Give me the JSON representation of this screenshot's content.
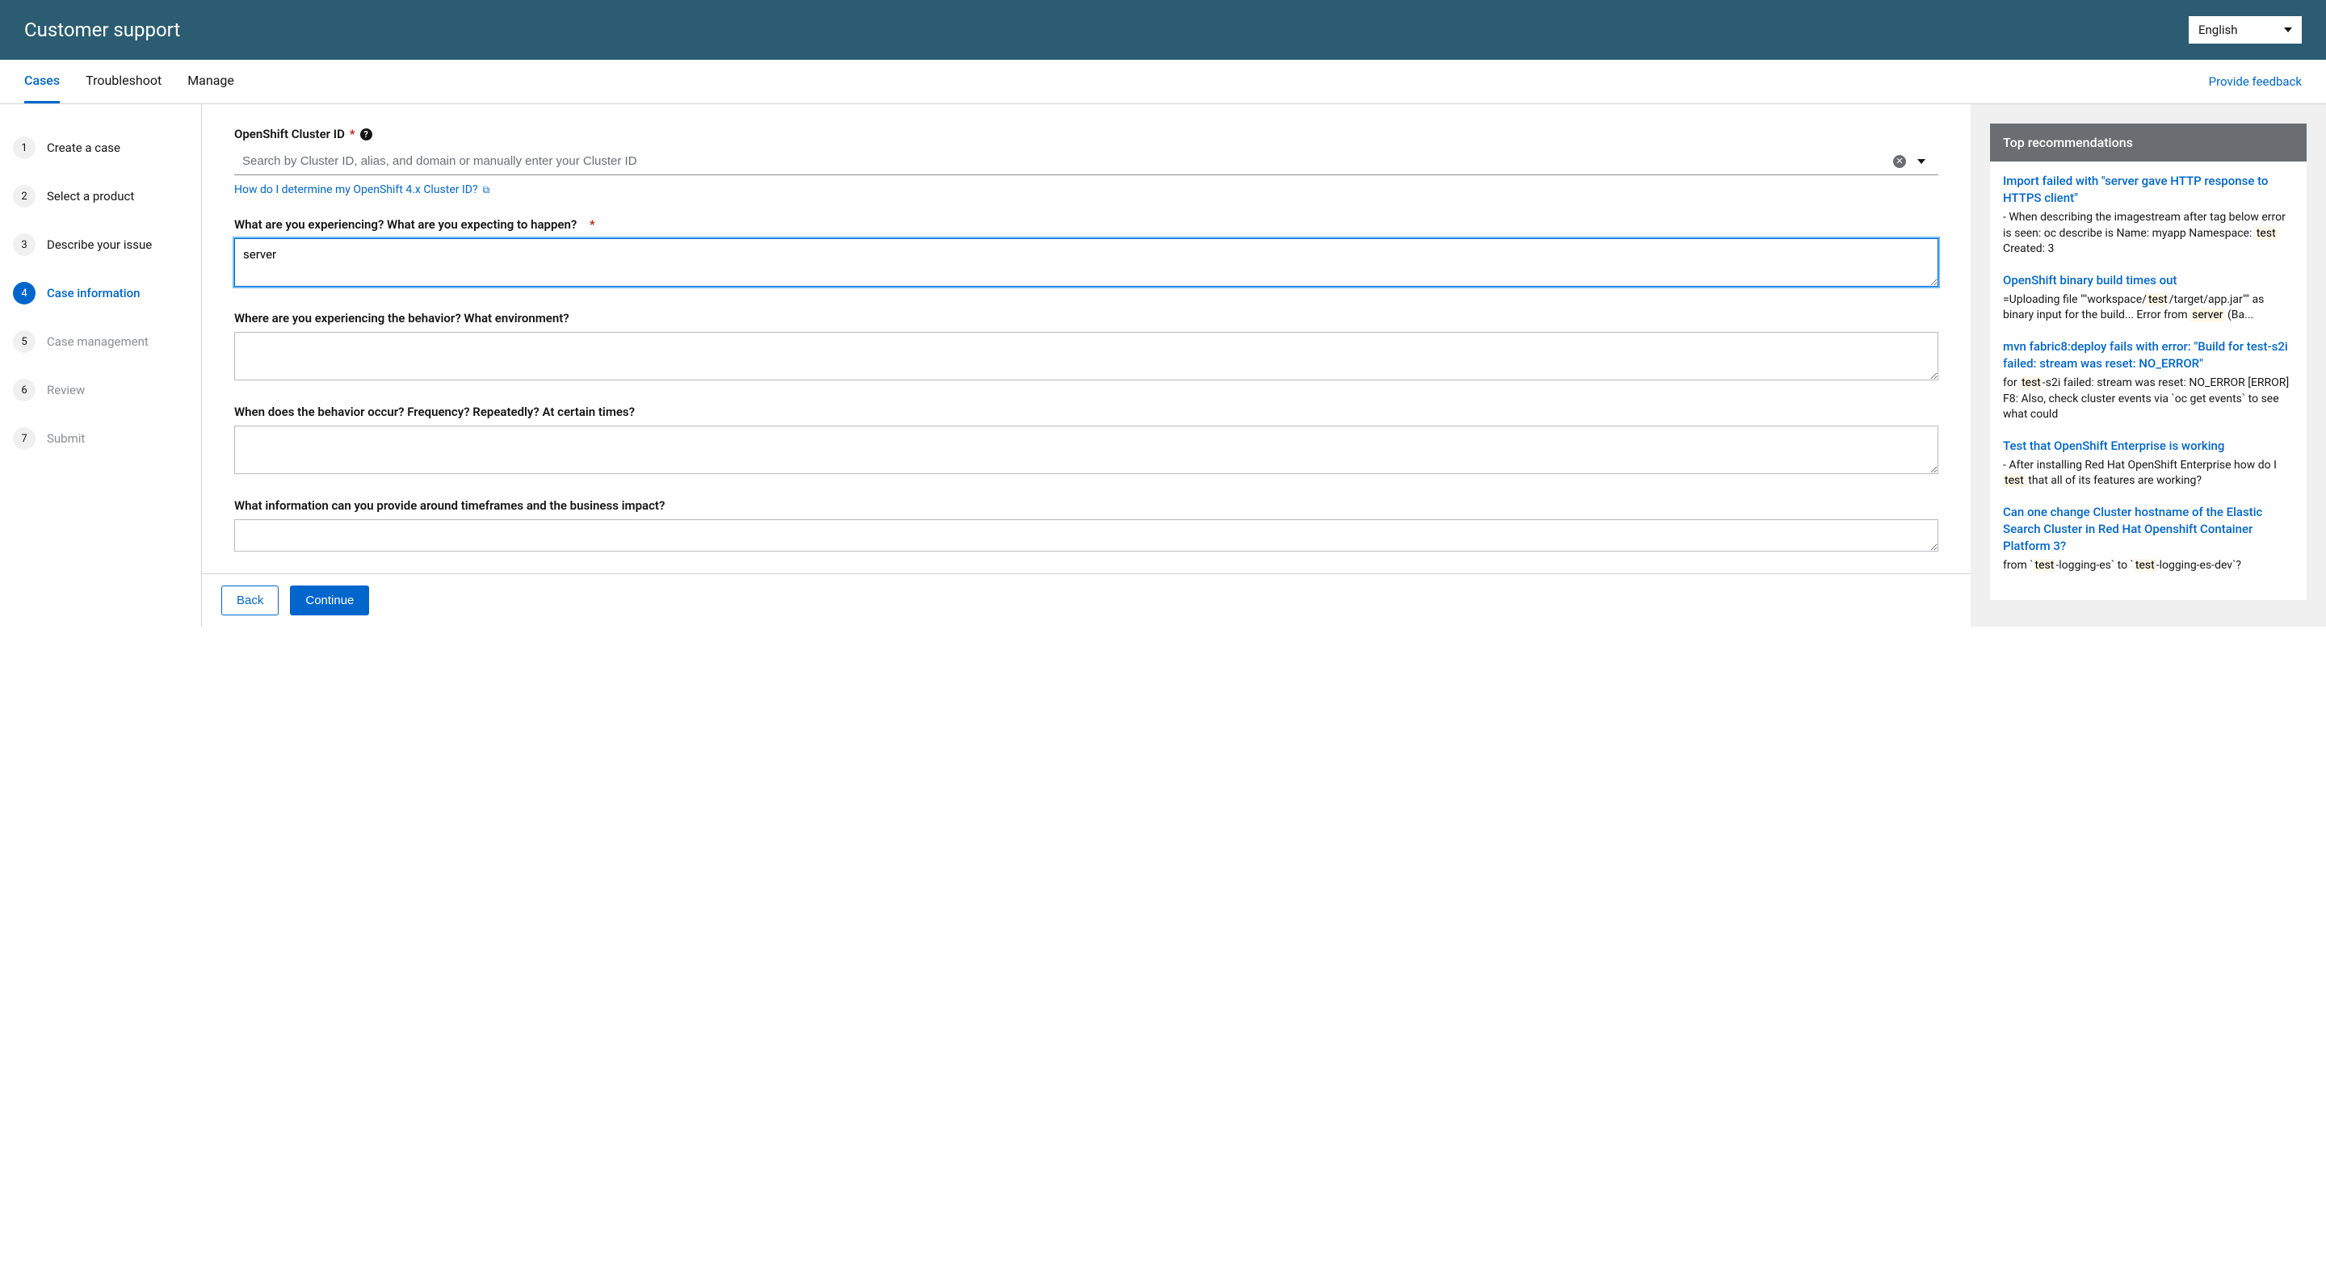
{
  "header": {
    "title": "Customer support",
    "language": "English"
  },
  "tabs": {
    "items": [
      {
        "label": "Cases",
        "active": true
      },
      {
        "label": "Troubleshoot",
        "active": false
      },
      {
        "label": "Manage",
        "active": false
      }
    ],
    "feedback": "Provide feedback"
  },
  "steps": [
    {
      "num": "1",
      "label": "Create a case",
      "state": "done"
    },
    {
      "num": "2",
      "label": "Select a product",
      "state": "done"
    },
    {
      "num": "3",
      "label": "Describe your issue",
      "state": "done"
    },
    {
      "num": "4",
      "label": "Case information",
      "state": "active"
    },
    {
      "num": "5",
      "label": "Case management",
      "state": "disabled"
    },
    {
      "num": "6",
      "label": "Review",
      "state": "disabled"
    },
    {
      "num": "7",
      "label": "Submit",
      "state": "disabled"
    }
  ],
  "form": {
    "cluster": {
      "label": "OpenShift Cluster ID",
      "required": "*",
      "placeholder": "Search by Cluster ID, alias, and domain or manually enter your Cluster ID",
      "help_link": "How do I determine my OpenShift 4.x Cluster ID?"
    },
    "experiencing": {
      "label": "What are you experiencing? What are you expecting to happen?",
      "required": "*",
      "value": "server"
    },
    "where": {
      "label": "Where are you experiencing the behavior? What environment?",
      "value": ""
    },
    "when": {
      "label": "When does the behavior occur? Frequency? Repeatedly? At certain times?",
      "value": ""
    },
    "timeframe": {
      "label": "What information can you provide around timeframes and the business impact?",
      "value": ""
    },
    "buttons": {
      "back": "Back",
      "continue": "Continue"
    }
  },
  "recommendations": {
    "header": "Top recommendations",
    "items": [
      {
        "title": "Import failed with \"server gave HTTP response to HTTPS client\"",
        "snippet_pre": "- When describing the imagestream after tag below error is seen: oc describe is Name: myapp Namespace: ",
        "hl1": "test",
        "snippet_post": " Created: 3"
      },
      {
        "title": "OpenShift binary build times out",
        "snippet_pre": "=Uploading file \"\"workspace/",
        "hl1": "test",
        "snippet_mid": "/target/app.jar\"\" as binary input for the build... Error from ",
        "hl2": "server",
        "snippet_post": " (Ba..."
      },
      {
        "title": "mvn fabric8:deploy fails with error: \"Build for test-s2i failed: stream was reset: NO_ERROR\"",
        "snippet_pre": "for ",
        "hl1": "test",
        "snippet_post": "-s2i failed: stream was reset: NO_ERROR [ERROR] F8: Also, check cluster events via `oc get events` to see what could"
      },
      {
        "title": "Test that OpenShift Enterprise is working",
        "snippet_pre": "- After installing Red Hat OpenShift Enterprise how do I ",
        "hl1": "test",
        "snippet_post": " that all of its features are working?"
      },
      {
        "title": "Can one change Cluster hostname of the Elastic Search Cluster in Red Hat Openshift Container Platform 3?",
        "snippet_pre": "from `",
        "hl1": "test",
        "snippet_mid": "-logging-es` to `",
        "hl2": "test",
        "snippet_post": "-logging-es-dev`?"
      }
    ]
  }
}
